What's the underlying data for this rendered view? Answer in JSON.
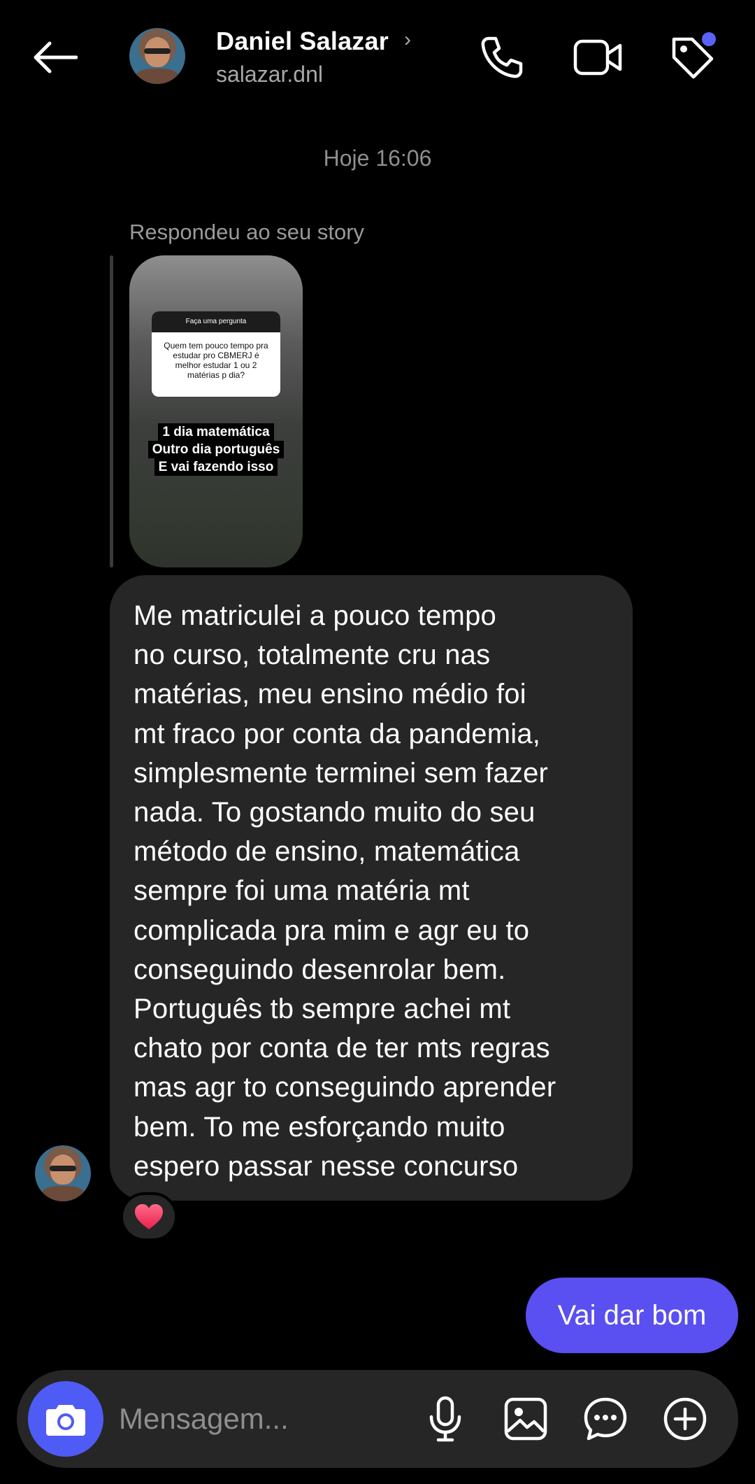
{
  "header": {
    "contact_name": "Daniel Salazar",
    "username": "salazar.dnl",
    "icons": [
      "back-arrow-icon",
      "phone-icon",
      "video-camera-icon",
      "tag-icon"
    ],
    "notification_color": "#5a63f5"
  },
  "thread": {
    "timestamp": "Hoje 16:06",
    "replied_label": "Respondeu ao seu story",
    "story": {
      "question_title": "Faça uma pergunta",
      "question_text": "Quem tem pouco tempo pra estudar pro CBMERJ é melhor estudar 1 ou 2 matérias p dia?",
      "answer_lines": [
        "1 dia matemática",
        "Outro dia português",
        "E vai fazendo isso"
      ]
    },
    "incoming_message": "Me matriculei a pouco tempo\nno curso, totalmente cru nas\nmatérias, meu ensino médio foi\nmt fraco por conta da pandemia,\nsimplesmente terminei sem fazer\nnada. To gostando muito do seu\nmétodo de ensino, matemática\nsempre foi uma matéria mt\ncomplicada pra mim e agr eu to\nconseguindo desenrolar bem.\nPortuguês tb sempre achei mt\nchato por conta de ter mts regras\nmas agr to conseguindo aprender\nbem. To me esforçando muito\nespero passar nesse concurso",
    "reaction": "heart-icon",
    "outgoing_message": "Vai dar bom",
    "outgoing_color": "#5a4ff0"
  },
  "composer": {
    "placeholder": "Mensagem...",
    "camera_color": "#4f5bf5",
    "icons": [
      "camera-icon",
      "microphone-icon",
      "gallery-icon",
      "sticker-icon",
      "plus-icon"
    ]
  }
}
